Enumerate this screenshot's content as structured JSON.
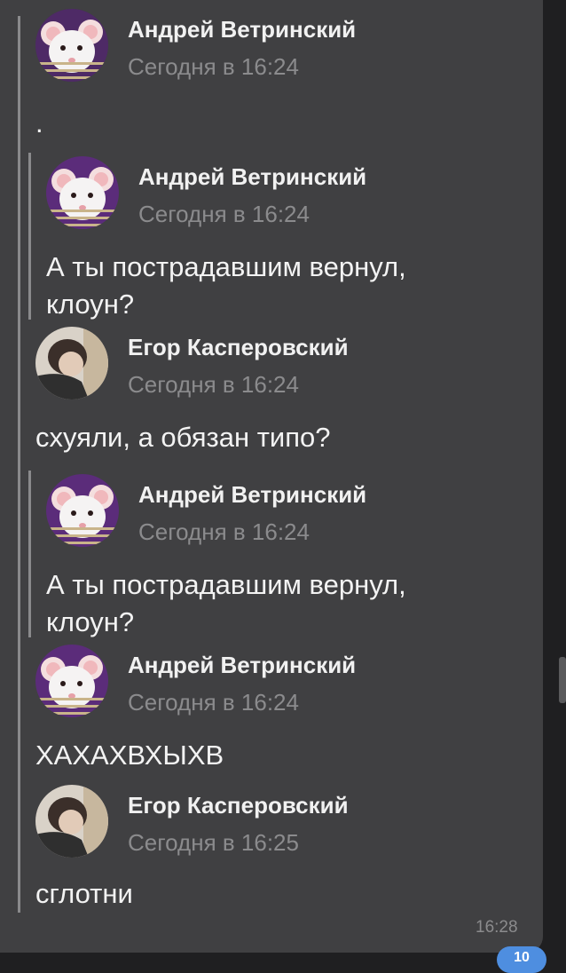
{
  "messages": {
    "m1": {
      "name": "Андрей Ветринский",
      "time": "Сегодня в 16:24",
      "avatar": "rat-avatar"
    },
    "m1_text": ".",
    "q1": {
      "name": "Андрей Ветринский",
      "time": "Сегодня в 16:24",
      "avatar": "rat-avatar"
    },
    "q1_text_1": "А ты пострадавшим вернул,",
    "q1_text_2": "клоун?",
    "m2": {
      "name": "Егор Касперовский",
      "time": "Сегодня в 16:24",
      "avatar": "person-avatar"
    },
    "m2_text": "схуяли, а обязан типо?",
    "q2": {
      "name": "Андрей Ветринский",
      "time": "Сегодня в 16:24",
      "avatar": "rat-avatar"
    },
    "q2_text_1": "А ты пострадавшим вернул,",
    "q2_text_2": "клоун?",
    "m3": {
      "name": "Андрей Ветринский",
      "time": "Сегодня в 16:24",
      "avatar": "rat-avatar"
    },
    "m3_text": "ХАХАХВХЫХВ",
    "m4": {
      "name": "Егор Касперовский",
      "time": "Сегодня в 16:25",
      "avatar": "person-avatar"
    },
    "m4_text": "сглотни"
  },
  "bubble_time": "16:28",
  "unread_badge": "10",
  "colors": {
    "background": "#1f1f21",
    "bubble": "#404042",
    "name": "#f1f1f1",
    "time": "#8b8b8d",
    "accent": "#4e8ee0"
  }
}
